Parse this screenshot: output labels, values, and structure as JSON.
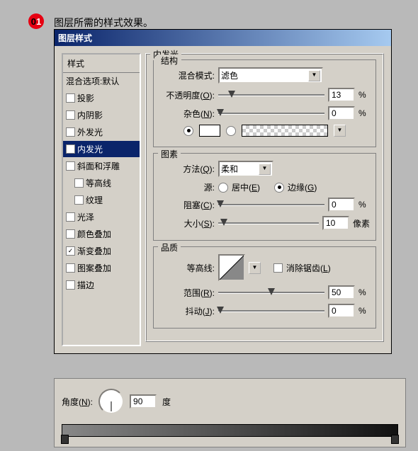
{
  "step": {
    "number_d1": "0",
    "number_d2": "1",
    "text": "图层所需的样式效果。"
  },
  "dialog": {
    "title": "图层样式"
  },
  "styles": {
    "header": "样式",
    "blend": "混合选项:默认",
    "items": [
      {
        "label": "投影",
        "checked": false
      },
      {
        "label": "内阴影",
        "checked": false
      },
      {
        "label": "外发光",
        "checked": false
      },
      {
        "label": "内发光",
        "checked": true,
        "active": true
      },
      {
        "label": "斜面和浮雕",
        "checked": false
      },
      {
        "label": "等高线",
        "checked": false,
        "indent": true
      },
      {
        "label": "纹理",
        "checked": false,
        "indent": true
      },
      {
        "label": "光泽",
        "checked": false
      },
      {
        "label": "颜色叠加",
        "checked": false
      },
      {
        "label": "渐变叠加",
        "checked": true
      },
      {
        "label": "图案叠加",
        "checked": false
      },
      {
        "label": "描边",
        "checked": false
      }
    ]
  },
  "panel": {
    "title": "内发光",
    "structure": {
      "legend": "结构",
      "blend_label": "混合模式:",
      "blend_value": "滤色",
      "opacity_label": "不透明度(",
      "opacity_key": "O",
      "opacity_suffix": "):",
      "opacity_value": "13",
      "opacity_unit": "%",
      "noise_label": "杂色(",
      "noise_key": "N",
      "noise_suffix": "):",
      "noise_value": "0",
      "noise_unit": "%"
    },
    "elements": {
      "legend": "图素",
      "tech_label": "方法(",
      "tech_key": "Q",
      "tech_suffix": "):",
      "tech_value": "柔和",
      "source_label": "源:",
      "center_label": "居中(",
      "center_key": "E",
      "center_suffix": ")",
      "edge_label": "边缘(",
      "edge_key": "G",
      "edge_suffix": ")",
      "choke_label": "阻塞(",
      "choke_key": "C",
      "choke_suffix": "):",
      "choke_value": "0",
      "choke_unit": "%",
      "size_label": "大小(",
      "size_key": "S",
      "size_suffix": "):",
      "size_value": "10",
      "size_unit": "像素"
    },
    "quality": {
      "legend": "品质",
      "contour_label": "等高线:",
      "aa_label": "消除锯齿(",
      "aa_key": "L",
      "aa_suffix": ")",
      "range_label": "范围(",
      "range_key": "R",
      "range_suffix": "):",
      "range_value": "50",
      "range_unit": "%",
      "jitter_label": "抖动(",
      "jitter_key": "J",
      "jitter_suffix": "):",
      "jitter_value": "0",
      "jitter_unit": "%"
    }
  },
  "angle": {
    "label": "角度(",
    "key": "N",
    "suffix": "):",
    "value": "90",
    "unit": "度"
  }
}
